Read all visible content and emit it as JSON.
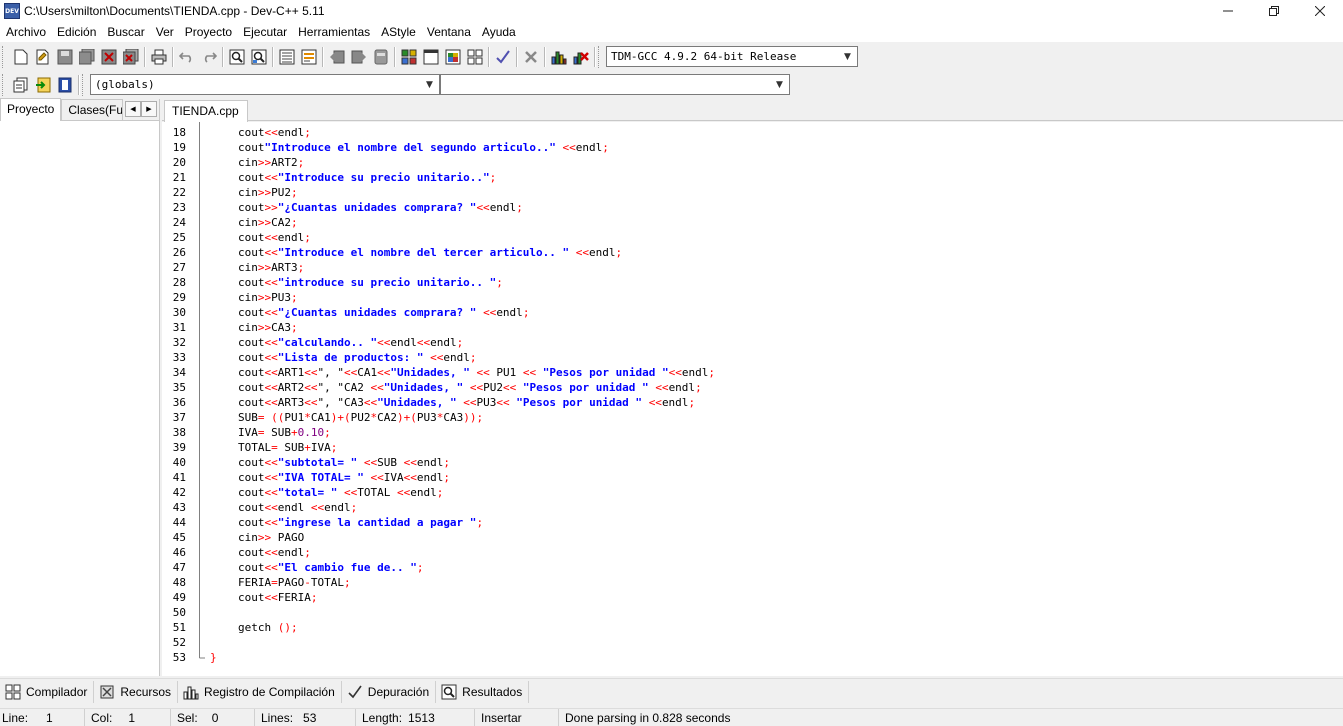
{
  "window": {
    "title": "C:\\Users\\milton\\Documents\\TIENDA.cpp - Dev-C++ 5.11",
    "icon_text": "DEV",
    "controls": [
      "minimize-icon",
      "maximize-icon",
      "close-icon"
    ]
  },
  "menu": [
    "Archivo",
    "Edición",
    "Buscar",
    "Ver",
    "Proyecto",
    "Ejecutar",
    "Herramientas",
    "AStyle",
    "Ventana",
    "Ayuda"
  ],
  "toolbar": {
    "compiler_select": "TDM-GCC 4.9.2 64-bit Release"
  },
  "toolbar2": {
    "scope_select": "(globals)",
    "member_select": ""
  },
  "left_panel": {
    "tabs": [
      "Proyecto",
      "Clases(Funciones)"
    ],
    "active": "Proyecto"
  },
  "editor": {
    "file_tab": "TIENDA.cpp",
    "lines": [
      {
        "n": "18",
        "tokens": [
          [
            "cout",
            "p"
          ],
          [
            "<<",
            "s"
          ],
          [
            "endl",
            "p"
          ],
          [
            ";",
            "s"
          ]
        ]
      },
      {
        "n": "19",
        "tokens": [
          [
            "cout",
            "p"
          ],
          [
            "\"Introduce el nombre del segundo articulo..\"",
            "str"
          ],
          [
            " ",
            "p"
          ],
          [
            "<<",
            "s"
          ],
          [
            "endl",
            "p"
          ],
          [
            ";",
            "s"
          ]
        ]
      },
      {
        "n": "20",
        "tokens": [
          [
            "cin",
            "p"
          ],
          [
            ">>",
            "s"
          ],
          [
            "ART2",
            "p"
          ],
          [
            ";",
            "s"
          ]
        ]
      },
      {
        "n": "21",
        "tokens": [
          [
            "cout",
            "p"
          ],
          [
            "<<",
            "s"
          ],
          [
            "\"Introduce su precio unitario..\"",
            "str"
          ],
          [
            ";",
            "s"
          ]
        ]
      },
      {
        "n": "22",
        "tokens": [
          [
            "cin",
            "p"
          ],
          [
            ">>",
            "s"
          ],
          [
            "PU2",
            "p"
          ],
          [
            ";",
            "s"
          ]
        ]
      },
      {
        "n": "23",
        "tokens": [
          [
            "cout",
            "p"
          ],
          [
            ">>",
            "s"
          ],
          [
            "\"¿Cuantas unidades comprara? \"",
            "str"
          ],
          [
            "<<",
            "s"
          ],
          [
            "endl",
            "p"
          ],
          [
            ";",
            "s"
          ]
        ]
      },
      {
        "n": "24",
        "tokens": [
          [
            "cin",
            "p"
          ],
          [
            ">>",
            "s"
          ],
          [
            "CA2",
            "p"
          ],
          [
            ";",
            "s"
          ]
        ]
      },
      {
        "n": "25",
        "tokens": [
          [
            "cout",
            "p"
          ],
          [
            "<<",
            "s"
          ],
          [
            "endl",
            "p"
          ],
          [
            ";",
            "s"
          ]
        ]
      },
      {
        "n": "26",
        "tokens": [
          [
            "cout",
            "p"
          ],
          [
            "<<",
            "s"
          ],
          [
            "\"Introduce el nombre del tercer articulo.. \"",
            "str"
          ],
          [
            " ",
            "p"
          ],
          [
            "<<",
            "s"
          ],
          [
            "endl",
            "p"
          ],
          [
            ";",
            "s"
          ]
        ]
      },
      {
        "n": "27",
        "tokens": [
          [
            "cin",
            "p"
          ],
          [
            ">>",
            "s"
          ],
          [
            "ART3",
            "p"
          ],
          [
            ";",
            "s"
          ]
        ]
      },
      {
        "n": "28",
        "tokens": [
          [
            "cout",
            "p"
          ],
          [
            "<<",
            "s"
          ],
          [
            "\"introduce su precio unitario.. \"",
            "str"
          ],
          [
            ";",
            "s"
          ]
        ]
      },
      {
        "n": "29",
        "tokens": [
          [
            "cin",
            "p"
          ],
          [
            ">>",
            "s"
          ],
          [
            "PU3",
            "p"
          ],
          [
            ";",
            "s"
          ]
        ]
      },
      {
        "n": "30",
        "tokens": [
          [
            "cout",
            "p"
          ],
          [
            "<<",
            "s"
          ],
          [
            "\"¿Cuantas unidades comprara? \"",
            "str"
          ],
          [
            " ",
            "p"
          ],
          [
            "<<",
            "s"
          ],
          [
            "endl",
            "p"
          ],
          [
            ";",
            "s"
          ]
        ]
      },
      {
        "n": "31",
        "tokens": [
          [
            "cin",
            "p"
          ],
          [
            ">>",
            "s"
          ],
          [
            "CA3",
            "p"
          ],
          [
            ";",
            "s"
          ]
        ]
      },
      {
        "n": "32",
        "tokens": [
          [
            "cout",
            "p"
          ],
          [
            "<<",
            "s"
          ],
          [
            "\"calculando.. \"",
            "str"
          ],
          [
            "<<",
            "s"
          ],
          [
            "endl",
            "p"
          ],
          [
            "<<",
            "s"
          ],
          [
            "endl",
            "p"
          ],
          [
            ";",
            "s"
          ]
        ]
      },
      {
        "n": "33",
        "tokens": [
          [
            "cout",
            "p"
          ],
          [
            "<<",
            "s"
          ],
          [
            "\"Lista de productos: \"",
            "str"
          ],
          [
            " ",
            "p"
          ],
          [
            "<<",
            "s"
          ],
          [
            "endl",
            "p"
          ],
          [
            ";",
            "s"
          ]
        ]
      },
      {
        "n": "34",
        "tokens": [
          [
            "cout",
            "p"
          ],
          [
            "<<",
            "s"
          ],
          [
            "ART1",
            "p"
          ],
          [
            "<<",
            "s"
          ],
          [
            "\", \"",
            "p"
          ],
          [
            "<<",
            "s"
          ],
          [
            "CA1",
            "p"
          ],
          [
            "<<",
            "s"
          ],
          [
            "\"Unidades, \"",
            "str"
          ],
          [
            " ",
            "p"
          ],
          [
            "<<",
            "s"
          ],
          [
            " PU1 ",
            "p"
          ],
          [
            "<<",
            "s"
          ],
          [
            " ",
            "p"
          ],
          [
            "\"Pesos por unidad \"",
            "str"
          ],
          [
            "<<",
            "s"
          ],
          [
            "endl",
            "p"
          ],
          [
            ";",
            "s"
          ]
        ]
      },
      {
        "n": "35",
        "tokens": [
          [
            "cout",
            "p"
          ],
          [
            "<<",
            "s"
          ],
          [
            "ART2",
            "p"
          ],
          [
            "<<",
            "s"
          ],
          [
            "\", \"CA2 ",
            "p"
          ],
          [
            "<<",
            "s"
          ],
          [
            "\"Unidades, \"",
            "str"
          ],
          [
            " ",
            "p"
          ],
          [
            "<<",
            "s"
          ],
          [
            "PU2",
            "p"
          ],
          [
            "<<",
            "s"
          ],
          [
            " ",
            "p"
          ],
          [
            "\"Pesos por unidad \"",
            "str"
          ],
          [
            " ",
            "p"
          ],
          [
            "<<",
            "s"
          ],
          [
            "endl",
            "p"
          ],
          [
            ";",
            "s"
          ]
        ]
      },
      {
        "n": "36",
        "tokens": [
          [
            "cout",
            "p"
          ],
          [
            "<<",
            "s"
          ],
          [
            "ART3",
            "p"
          ],
          [
            "<<",
            "s"
          ],
          [
            "\", \"CA3",
            "p"
          ],
          [
            "<<",
            "s"
          ],
          [
            "\"Unidades, \"",
            "str"
          ],
          [
            " ",
            "p"
          ],
          [
            "<<",
            "s"
          ],
          [
            "PU3",
            "p"
          ],
          [
            "<<",
            "s"
          ],
          [
            " ",
            "p"
          ],
          [
            "\"Pesos por unidad \"",
            "str"
          ],
          [
            " ",
            "p"
          ],
          [
            "<<",
            "s"
          ],
          [
            "endl",
            "p"
          ],
          [
            ";",
            "s"
          ]
        ]
      },
      {
        "n": "37",
        "tokens": [
          [
            "SUB",
            "p"
          ],
          [
            "=",
            "s"
          ],
          [
            " ",
            "p"
          ],
          [
            "((",
            "s"
          ],
          [
            "PU1",
            "p"
          ],
          [
            "*",
            "s"
          ],
          [
            "CA1",
            "p"
          ],
          [
            ")+(",
            "s"
          ],
          [
            "PU2",
            "p"
          ],
          [
            "*",
            "s"
          ],
          [
            "CA2",
            "p"
          ],
          [
            ")+(",
            "s"
          ],
          [
            "PU3",
            "p"
          ],
          [
            "*",
            "s"
          ],
          [
            "CA3",
            "p"
          ],
          [
            "));",
            "s"
          ]
        ]
      },
      {
        "n": "38",
        "tokens": [
          [
            "IVA",
            "p"
          ],
          [
            "=",
            "s"
          ],
          [
            " SUB",
            "p"
          ],
          [
            "+",
            "s"
          ],
          [
            "0.10",
            "num"
          ],
          [
            ";",
            "s"
          ]
        ]
      },
      {
        "n": "39",
        "tokens": [
          [
            "TOTAL",
            "p"
          ],
          [
            "=",
            "s"
          ],
          [
            " SUB",
            "p"
          ],
          [
            "+",
            "s"
          ],
          [
            "IVA",
            "p"
          ],
          [
            ";",
            "s"
          ]
        ]
      },
      {
        "n": "40",
        "tokens": [
          [
            "cout",
            "p"
          ],
          [
            "<<",
            "s"
          ],
          [
            "\"subtotal= \"",
            "str"
          ],
          [
            " ",
            "p"
          ],
          [
            "<<",
            "s"
          ],
          [
            "SUB ",
            "p"
          ],
          [
            "<<",
            "s"
          ],
          [
            "endl",
            "p"
          ],
          [
            ";",
            "s"
          ]
        ]
      },
      {
        "n": "41",
        "tokens": [
          [
            "cout",
            "p"
          ],
          [
            "<<",
            "s"
          ],
          [
            "\"IVA TOTAL= \"",
            "str"
          ],
          [
            " ",
            "p"
          ],
          [
            "<<",
            "s"
          ],
          [
            "IVA",
            "p"
          ],
          [
            "<<",
            "s"
          ],
          [
            "endl",
            "p"
          ],
          [
            ";",
            "s"
          ]
        ]
      },
      {
        "n": "42",
        "tokens": [
          [
            "cout",
            "p"
          ],
          [
            "<<",
            "s"
          ],
          [
            "\"total= \"",
            "str"
          ],
          [
            " ",
            "p"
          ],
          [
            "<<",
            "s"
          ],
          [
            "TOTAL ",
            "p"
          ],
          [
            "<<",
            "s"
          ],
          [
            "endl",
            "p"
          ],
          [
            ";",
            "s"
          ]
        ]
      },
      {
        "n": "43",
        "tokens": [
          [
            "cout",
            "p"
          ],
          [
            "<<",
            "s"
          ],
          [
            "endl ",
            "p"
          ],
          [
            "<<",
            "s"
          ],
          [
            "endl",
            "p"
          ],
          [
            ";",
            "s"
          ]
        ]
      },
      {
        "n": "44",
        "tokens": [
          [
            "cout",
            "p"
          ],
          [
            "<<",
            "s"
          ],
          [
            "\"ingrese la cantidad a pagar \"",
            "str"
          ],
          [
            ";",
            "s"
          ]
        ]
      },
      {
        "n": "45",
        "tokens": [
          [
            "cin",
            "p"
          ],
          [
            ">>",
            "s"
          ],
          [
            " PAGO",
            "p"
          ]
        ]
      },
      {
        "n": "46",
        "tokens": [
          [
            "cout",
            "p"
          ],
          [
            "<<",
            "s"
          ],
          [
            "endl",
            "p"
          ],
          [
            ";",
            "s"
          ]
        ]
      },
      {
        "n": "47",
        "tokens": [
          [
            "cout",
            "p"
          ],
          [
            "<<",
            "s"
          ],
          [
            "\"El cambio fue de.. \"",
            "str"
          ],
          [
            ";",
            "s"
          ]
        ]
      },
      {
        "n": "48",
        "tokens": [
          [
            "FERIA",
            "p"
          ],
          [
            "=",
            "s"
          ],
          [
            "PAGO",
            "p"
          ],
          [
            "-",
            "s"
          ],
          [
            "TOTAL",
            "p"
          ],
          [
            ";",
            "s"
          ]
        ]
      },
      {
        "n": "49",
        "tokens": [
          [
            "cout",
            "p"
          ],
          [
            "<<",
            "s"
          ],
          [
            "FERIA",
            "p"
          ],
          [
            ";",
            "s"
          ]
        ]
      },
      {
        "n": "50",
        "tokens": []
      },
      {
        "n": "51",
        "tokens": [
          [
            "getch ",
            "p"
          ],
          [
            "();",
            "s"
          ]
        ]
      },
      {
        "n": "52",
        "tokens": []
      },
      {
        "n": "53",
        "tokens": [
          [
            "}",
            "brace"
          ]
        ],
        "outdent": true
      }
    ]
  },
  "bottom_tabs": [
    {
      "label": "Compilador",
      "icon": "compiler-grid-icon"
    },
    {
      "label": "Recursos",
      "icon": "resources-icon"
    },
    {
      "label": "Registro de Compilación",
      "icon": "bar-chart-icon"
    },
    {
      "label": "Depuración",
      "icon": "checkmark-icon"
    },
    {
      "label": "Resultados",
      "icon": "search-results-icon"
    }
  ],
  "status": {
    "line_label": "Line:",
    "line_value": "1",
    "col_label": "Col:",
    "col_value": "1",
    "sel_label": "Sel:",
    "sel_value": "0",
    "lines_label": "Lines:",
    "lines_value": "53",
    "length_label": "Length:",
    "length_value": "1513",
    "mode": "Insertar",
    "message": "Done parsing in 0.828 seconds"
  },
  "colors": {
    "string": "#0000ff",
    "symbol": "#ff0000",
    "number": "#800080",
    "editor_bg": "#ffffff",
    "chrome_bg": "#f0f0f0"
  }
}
